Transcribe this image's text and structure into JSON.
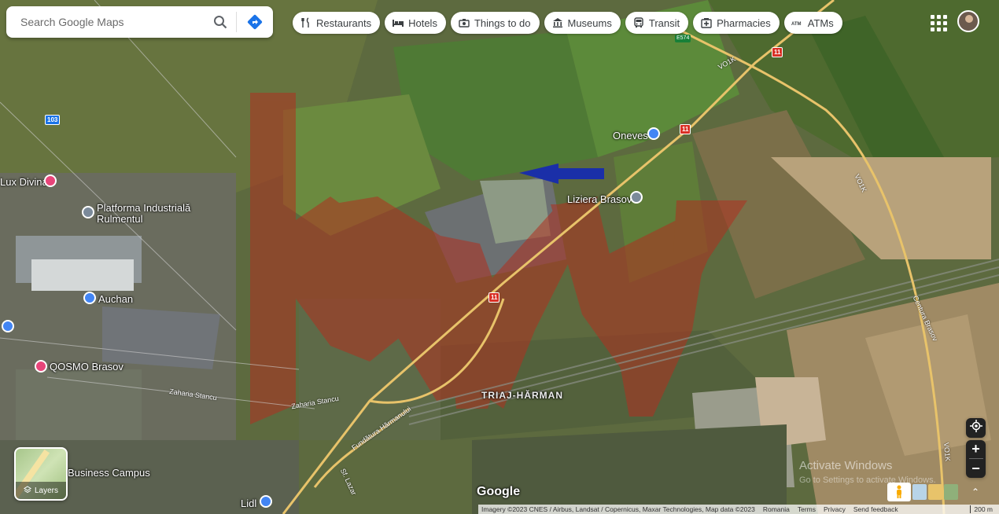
{
  "search": {
    "placeholder": "Search Google Maps"
  },
  "chips": [
    {
      "label": "Restaurants",
      "icon": "fork-knife-icon"
    },
    {
      "label": "Hotels",
      "icon": "bed-icon"
    },
    {
      "label": "Things to do",
      "icon": "camera-icon"
    },
    {
      "label": "Museums",
      "icon": "museum-icon"
    },
    {
      "label": "Transit",
      "icon": "bus-icon"
    },
    {
      "label": "Pharmacies",
      "icon": "pharmacy-icon"
    },
    {
      "label": "ATMs",
      "icon": "atm-icon"
    }
  ],
  "places": {
    "lux_divina": "Lux Divina",
    "platforma": "Platforma Industrială Rulmentul",
    "auchan": "Auchan",
    "qosmo": "QOSMO Brasov",
    "business_campus": "Business Campus",
    "lidl": "Lidl",
    "oneves": "Oneves",
    "liziera": "Liziera Brasov",
    "triaj": "TRIAJ-HĂRMAN"
  },
  "roads": {
    "r103": "103",
    "r11": "11",
    "e574": "E574",
    "vo1": "VO1K",
    "vo2": "VO1K",
    "vo3": "VO1K",
    "centura": "Centura Brasov",
    "zaharia": "Zaharia Stancu",
    "zaharia2": "Zaharia Stancu",
    "fundatura": "Fundătura Hărmanului",
    "sf_lazar": "Sf. Lazar"
  },
  "layers": {
    "label": "Layers"
  },
  "windows": {
    "activate": "Activate Windows",
    "goto": "Go to Settings to activate Windows."
  },
  "logo": "Google",
  "footer": {
    "imagery": "Imagery ©2023 CNES / Airbus, Landsat / Copernicus, Maxar Technologies, Map data ©2023",
    "country": "Romania",
    "terms": "Terms",
    "privacy": "Privacy",
    "feedback": "Send feedback",
    "scale": "200 m"
  },
  "colors": {
    "overlay_red": "#b03020",
    "arrow_blue": "#1a2fa8",
    "road_yellow": "#e8c36a",
    "pin_blue": "#4285f4",
    "pin_pink": "#e8457a"
  }
}
